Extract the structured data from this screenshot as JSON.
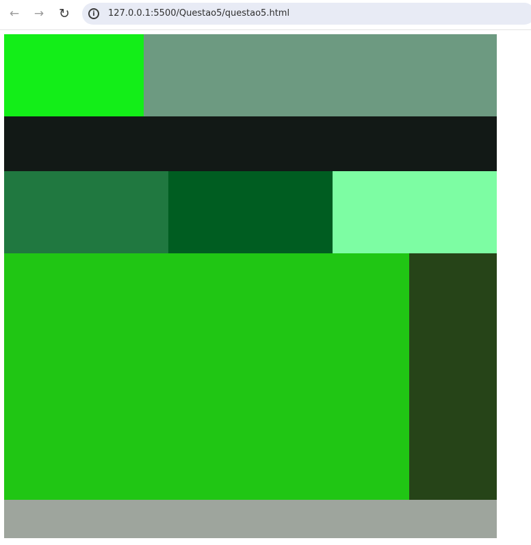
{
  "browser": {
    "back_icon": "arrow-left-icon",
    "forward_icon": "arrow-right-icon",
    "reload_icon": "reload-icon",
    "info_icon": "info-icon",
    "url": "127.0.0.1:5500/Questao5/questao5.html"
  },
  "page": {
    "blocks": [
      {
        "name": "block-1",
        "color": "#13ee18"
      },
      {
        "name": "block-2",
        "color": "#6d9a81"
      },
      {
        "name": "block-3",
        "color": "#121916"
      },
      {
        "name": "block-4",
        "color": "#207840"
      },
      {
        "name": "block-5",
        "color": "#005d21"
      },
      {
        "name": "block-6",
        "color": "#7dfda3"
      },
      {
        "name": "block-7",
        "color": "#20c614"
      },
      {
        "name": "block-8",
        "color": "#264418"
      },
      {
        "name": "block-9",
        "color": "#9ea59d"
      }
    ]
  }
}
